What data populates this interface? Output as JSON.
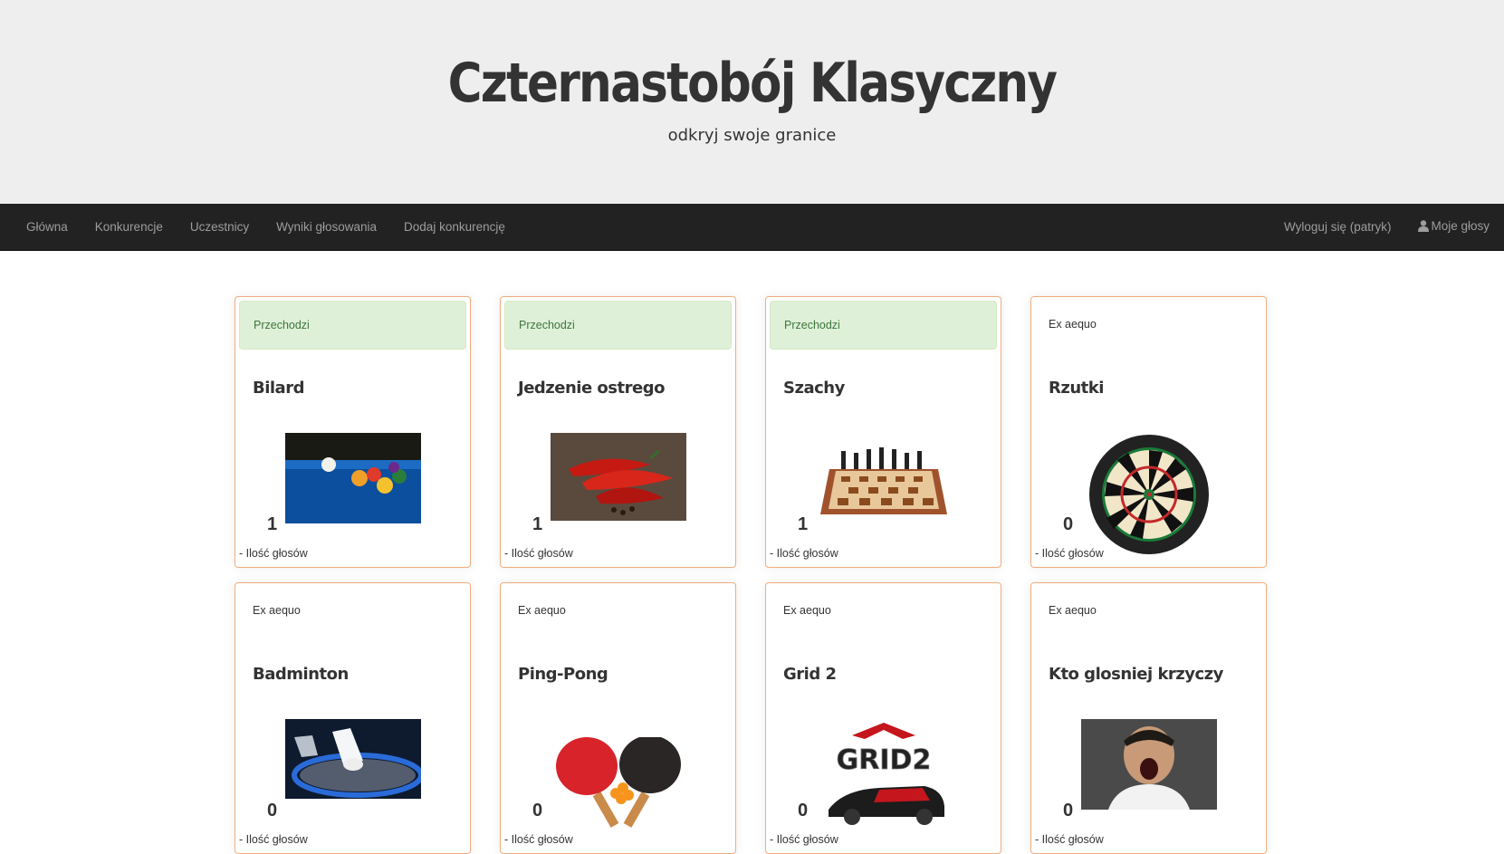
{
  "header": {
    "title": "Czternastobój Klasyczny",
    "subtitle": "odkryj swoje granice"
  },
  "nav": {
    "left": [
      "Główna",
      "Konkurencje",
      "Uczestnicy",
      "Wyniki głosowania",
      "Dodaj konkurencję"
    ],
    "logout": "Wyloguj się (patryk)",
    "my_votes": "Moje głosy"
  },
  "vote_label": "- Ilość głosów",
  "cards": [
    {
      "status": "Przechodzi",
      "status_type": "pass",
      "name": "Bilard",
      "votes": "1",
      "image": "billiard-balls"
    },
    {
      "status": "Przechodzi",
      "status_type": "pass",
      "name": "Jedzenie ostrego",
      "votes": "1",
      "image": "chili-peppers"
    },
    {
      "status": "Przechodzi",
      "status_type": "pass",
      "name": "Szachy",
      "votes": "1",
      "image": "chessboard"
    },
    {
      "status": "Ex aequo",
      "status_type": "tie",
      "name": "Rzutki",
      "votes": "0",
      "image": "dartboard"
    },
    {
      "status": "Ex aequo",
      "status_type": "tie",
      "name": "Badminton",
      "votes": "0",
      "image": "shuttlecock-racket"
    },
    {
      "status": "Ex aequo",
      "status_type": "tie",
      "name": "Ping-Pong",
      "votes": "0",
      "image": "ping-pong-paddles"
    },
    {
      "status": "Ex aequo",
      "status_type": "tie",
      "name": "Grid 2",
      "votes": "0",
      "image": "grid2-logo-car"
    },
    {
      "status": "Ex aequo",
      "status_type": "tie",
      "name": "Kto glosniej krzyczy",
      "votes": "0",
      "image": "screaming-man"
    }
  ],
  "colors": {
    "nav_bg": "#222222",
    "jumbotron_bg": "#eeeeee",
    "pass_bg": "#dff0d8",
    "card_border": "#f0ad7e"
  }
}
